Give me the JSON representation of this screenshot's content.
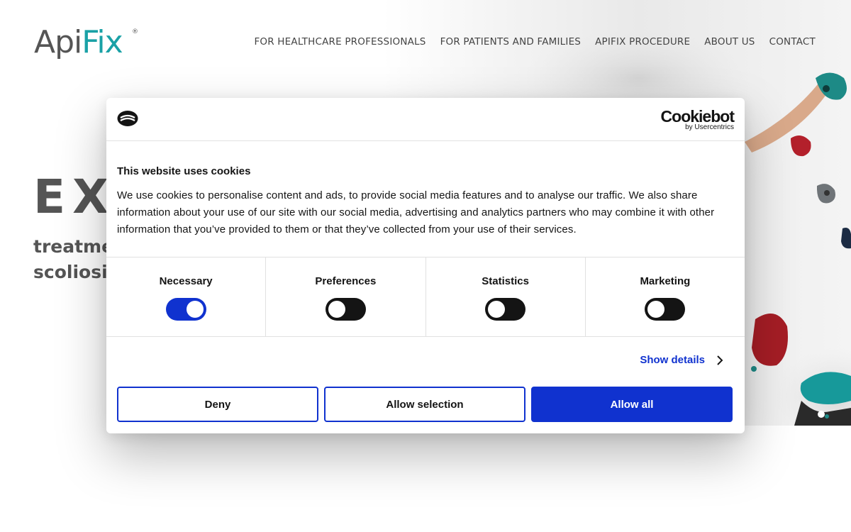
{
  "site": {
    "logo": {
      "text_main": "Api",
      "text_accent": "Fix",
      "registered": "®"
    },
    "nav": [
      {
        "label": "FOR HEALTHCARE PROFESSIONALS"
      },
      {
        "label": "FOR PATIENTS AND FAMILIES"
      },
      {
        "label": "APIFIX PROCEDURE"
      },
      {
        "label": "ABOUT US"
      },
      {
        "label": "CONTACT"
      }
    ],
    "hero": {
      "title": "EX",
      "subtitle_line1": "treatme",
      "subtitle_line2": "scoliosis"
    }
  },
  "cookie_dialog": {
    "brand_name": "Cookiebot",
    "brand_by": "by Usercentrics",
    "title": "This website uses cookies",
    "text": "We use cookies to personalise content and ads, to provide social media features and to analyse our traffic. We also share information about your use of our site with our social media, advertising and analytics partners who may combine it with other information that you’ve provided to them or that they’ve collected from your use of their services.",
    "toggles": [
      {
        "label": "Necessary",
        "checked": true
      },
      {
        "label": "Preferences",
        "checked": false
      },
      {
        "label": "Statistics",
        "checked": false
      },
      {
        "label": "Marketing",
        "checked": false
      }
    ],
    "show_details": "Show details",
    "buttons": {
      "deny": "Deny",
      "allow_selection": "Allow selection",
      "allow_all": "Allow all"
    },
    "colors": {
      "accent": "#1032cf",
      "text": "#141414",
      "toggle_off": "#141414"
    }
  }
}
